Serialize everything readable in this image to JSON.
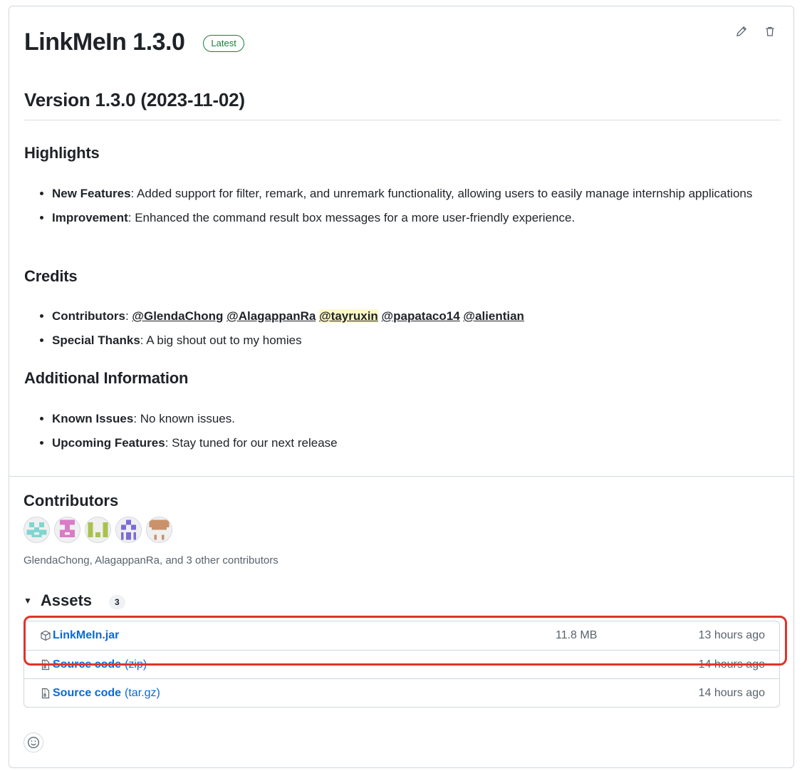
{
  "release": {
    "title": "LinkMeIn 1.3.0",
    "badge": "Latest"
  },
  "actions": {
    "edit_icon": "pencil-icon",
    "delete_icon": "trash-icon"
  },
  "notes": {
    "version_heading": "Version 1.3.0 (2023-11-02)",
    "highlights": {
      "heading": "Highlights",
      "items": [
        {
          "label": "New Features",
          "text": ": Added support for filter, remark, and unremark functionality, allowing users to easily manage internship applications"
        },
        {
          "label": "Improvement",
          "text": ": Enhanced the command result box messages for a more user-friendly experience."
        }
      ]
    },
    "credits": {
      "heading": "Credits",
      "contributors_label": "Contributors",
      "contributors_sep": ": ",
      "mentions": [
        "@GlendaChong",
        "@AlagappanRa",
        "@tayruxin",
        "@papataco14",
        "@alientian"
      ],
      "special_label": "Special Thanks",
      "special_text": ": A big shout out to my homies"
    },
    "additional": {
      "heading": "Additional Information",
      "items": [
        {
          "label": "Known Issues",
          "text": ": No known issues."
        },
        {
          "label": "Upcoming Features",
          "text": ": Stay tuned for our next release"
        }
      ]
    }
  },
  "contributors": {
    "heading": "Contributors",
    "summary": "GlendaChong, AlagappanRa, and 3 other contributors",
    "avatar_colors": [
      "#7fd6d0",
      "#d97bc6",
      "#a9c24e",
      "#7b6bd6",
      "#c9926a"
    ]
  },
  "assets": {
    "heading": "Assets",
    "count": "3",
    "rows": [
      {
        "icon": "package-icon",
        "name": "LinkMeIn.jar",
        "ext": "",
        "size": "11.8 MB",
        "time": "13 hours ago"
      },
      {
        "icon": "file-zip-icon",
        "name": "Source code",
        "ext": "(zip)",
        "size": "",
        "time": "14 hours ago"
      },
      {
        "icon": "file-zip-icon",
        "name": "Source code",
        "ext": "(tar.gz)",
        "size": "",
        "time": "14 hours ago"
      }
    ]
  },
  "colors": {
    "link": "#0969da",
    "badge_green": "#1a7f37",
    "annotation_red": "#e0342c",
    "mention_highlight": "#fff8c5"
  }
}
